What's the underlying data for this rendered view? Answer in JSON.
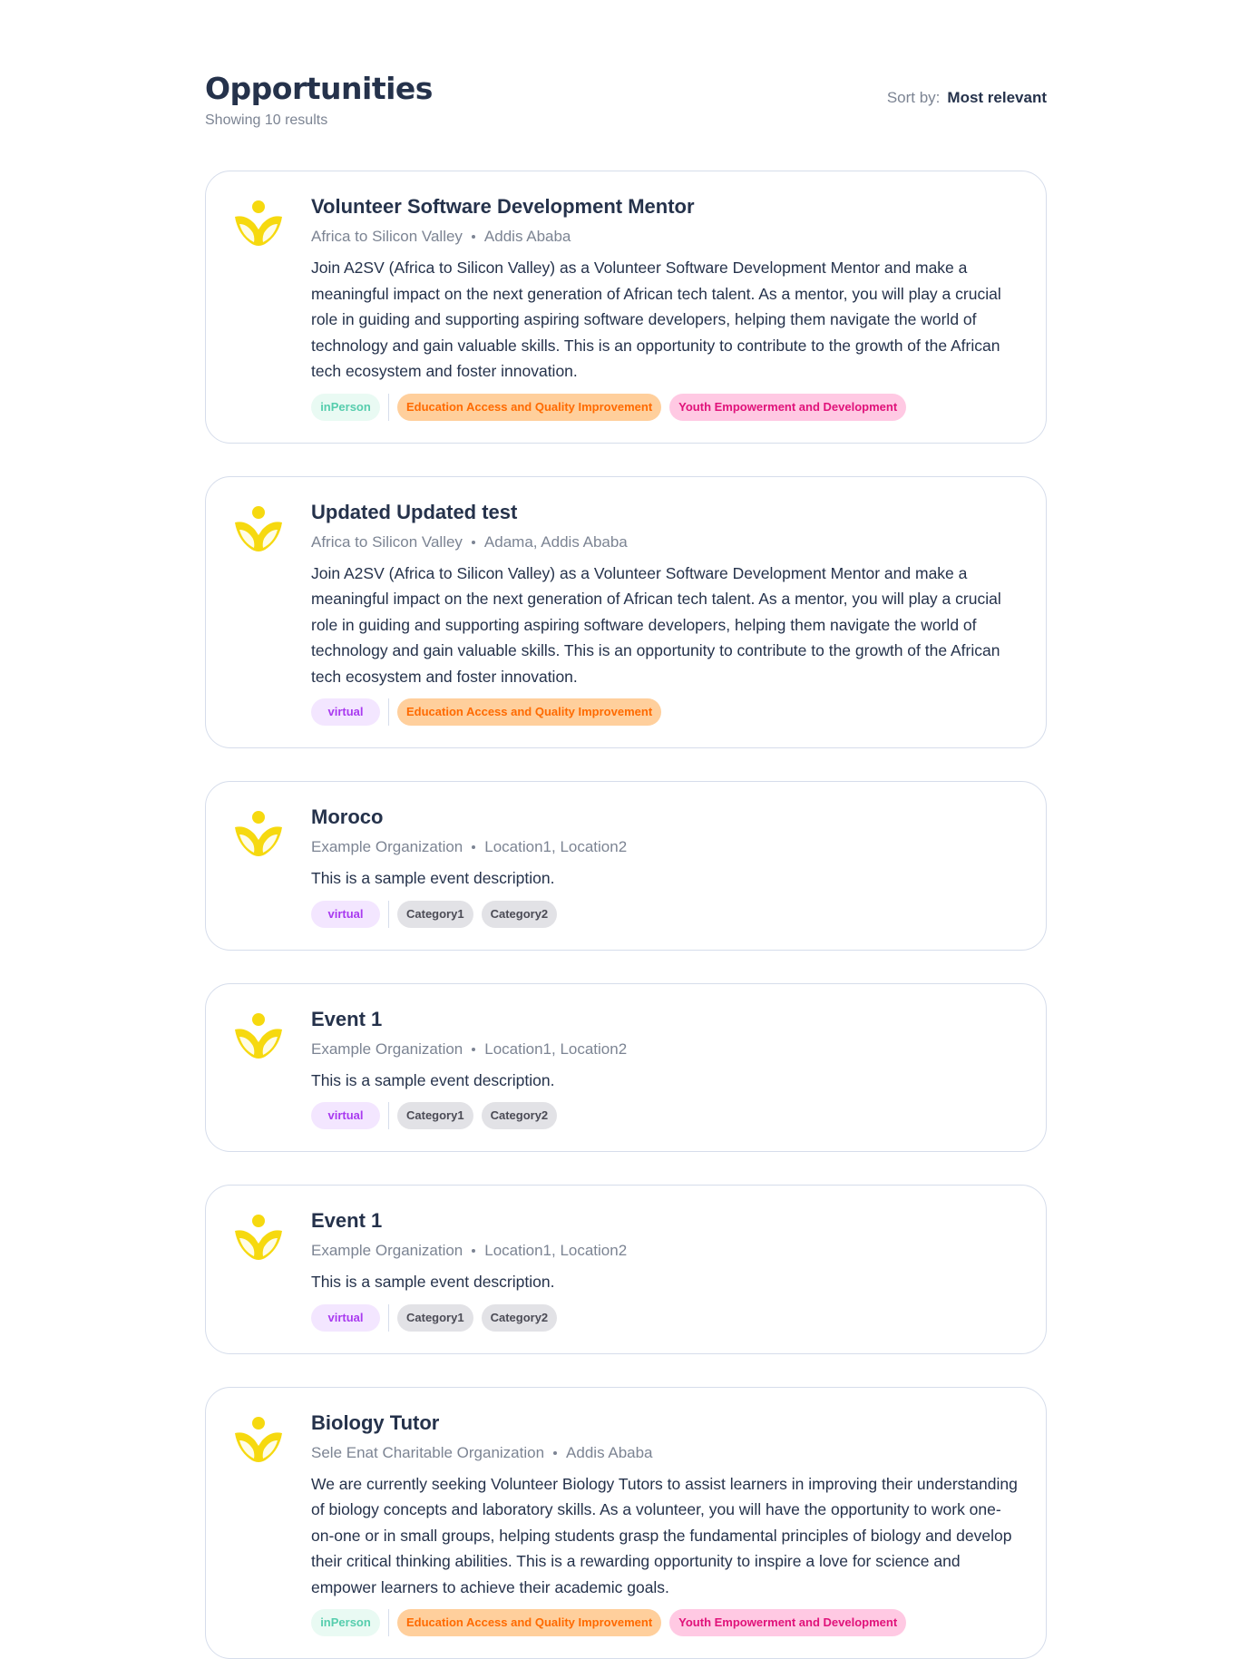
{
  "header": {
    "title": "Opportunities",
    "subtitle": "Showing 10 results",
    "sort_label": "Sort by:",
    "sort_value": "Most relevant"
  },
  "colors": {
    "title": "#25324b",
    "muted": "#7c8493",
    "border": "#d6ddeb",
    "logo": "#f6d90f"
  },
  "cards": [
    {
      "title": "Volunteer Software Development Mentor",
      "org": "Africa to Silicon Valley",
      "location": "Addis Ababa",
      "description": "Join A2SV (Africa to Silicon Valley) as a Volunteer Software Development Mentor and make a meaningful impact on the next generation of African tech talent. As a mentor, you will play a crucial role in guiding and supporting aspiring software developers, helping them navigate the world of technology and gain valuable skills. This is an opportunity to contribute to the growth of the African tech ecosystem and foster innovation.",
      "mode": "inPerson",
      "categories": [
        "Education Access and Quality Improvement",
        "Youth Empowerment and Development"
      ]
    },
    {
      "title": "Updated Updated test",
      "org": "Africa to Silicon Valley",
      "location": "Adama, Addis Ababa",
      "description": "Join A2SV (Africa to Silicon Valley) as a Volunteer Software Development Mentor and make a meaningful impact on the next generation of African tech talent. As a mentor, you will play a crucial role in guiding and supporting aspiring software developers, helping them navigate the world of technology and gain valuable skills. This is an opportunity to contribute to the growth of the African tech ecosystem and foster innovation.",
      "mode": "virtual",
      "categories": [
        "Education Access and Quality Improvement"
      ]
    },
    {
      "title": "Moroco",
      "org": "Example Organization",
      "location": "Location1, Location2",
      "description": "This is a sample event description.",
      "mode": "virtual",
      "categories": [
        "Category1",
        "Category2"
      ]
    },
    {
      "title": "Event 1",
      "org": "Example Organization",
      "location": "Location1, Location2",
      "description": "This is a sample event description.",
      "mode": "virtual",
      "categories": [
        "Category1",
        "Category2"
      ]
    },
    {
      "title": "Event 1",
      "org": "Example Organization",
      "location": "Location1, Location2",
      "description": "This is a sample event description.",
      "mode": "virtual",
      "categories": [
        "Category1",
        "Category2"
      ]
    },
    {
      "title": "Biology Tutor",
      "org": "Sele Enat Charitable Organization",
      "location": "Addis Ababa",
      "description": "We are currently seeking Volunteer Biology Tutors to assist learners in improving their understanding of biology concepts and laboratory skills. As a volunteer, you will have the opportunity to work one-on-one or in small groups, helping students grasp the fundamental principles of biology and develop their critical thinking abilities. This is a rewarding opportunity to inspire a love for science and empower learners to achieve their academic goals.",
      "mode": "inPerson",
      "categories": [
        "Education Access and Quality Improvement",
        "Youth Empowerment and Development"
      ]
    }
  ]
}
